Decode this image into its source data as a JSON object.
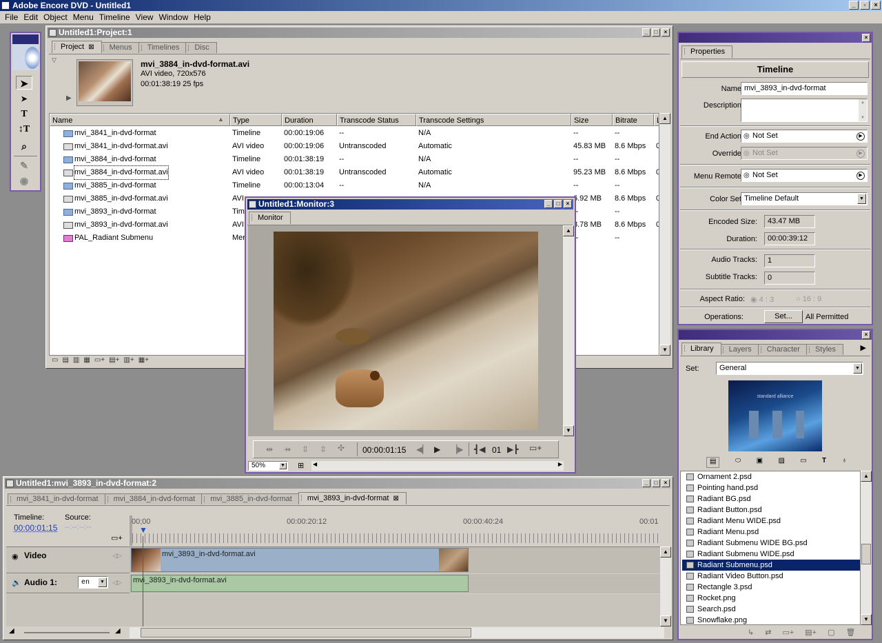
{
  "app": {
    "title": "Adobe Encore DVD - Untitled1"
  },
  "menu": [
    "File",
    "Edit",
    "Object",
    "Menu",
    "Timeline",
    "View",
    "Window",
    "Help"
  ],
  "project": {
    "title": "Untitled1:Project:1",
    "tabs": [
      "Project",
      "Menus",
      "Timelines",
      "Disc"
    ],
    "preview": {
      "name": "mvi_3884_in-dvd-format.avi",
      "type": "AVI video, 720x576",
      "duration": "00:01:38:19 25 fps"
    },
    "columns": [
      "Name",
      "Type",
      "Duration",
      "Transcode Status",
      "Transcode Settings",
      "Size",
      "Bitrate",
      "Last"
    ],
    "rows": [
      {
        "icon": "timeline",
        "name": "mvi_3841_in-dvd-format",
        "type": "Timeline",
        "duration": "00:00:19:06",
        "status": "--",
        "settings": "N/A",
        "size": "--",
        "bitrate": "--",
        "last": ""
      },
      {
        "icon": "avi",
        "name": "mvi_3841_in-dvd-format.avi",
        "type": "AVI video",
        "duration": "00:00:19:06",
        "status": "Untranscoded",
        "settings": "Automatic",
        "size": "45.83 MB",
        "bitrate": "8.6 Mbps",
        "last": "0"
      },
      {
        "icon": "timeline",
        "name": "mvi_3884_in-dvd-format",
        "type": "Timeline",
        "duration": "00:01:38:19",
        "status": "--",
        "settings": "N/A",
        "size": "--",
        "bitrate": "--",
        "last": ""
      },
      {
        "icon": "avi",
        "name": "mvi_3884_in-dvd-format.avi",
        "type": "AVI video",
        "duration": "00:01:38:19",
        "status": "Untranscoded",
        "settings": "Automatic",
        "size": "95.23 MB",
        "bitrate": "8.6 Mbps",
        "last": "0"
      },
      {
        "icon": "timeline",
        "name": "mvi_3885_in-dvd-format",
        "type": "Timeline",
        "duration": "00:00:13:04",
        "status": "--",
        "settings": "N/A",
        "size": "--",
        "bitrate": "--",
        "last": ""
      },
      {
        "icon": "avi",
        "name": "mvi_3885_in-dvd-format.avi",
        "type": "AVI",
        "duration": "",
        "status": "",
        "settings": "",
        "size": "6.92 MB",
        "bitrate": "8.6 Mbps",
        "last": "0"
      },
      {
        "icon": "timeline",
        "name": "mvi_3893_in-dvd-format",
        "type": "Tim",
        "duration": "",
        "status": "",
        "settings": "",
        "size": "--",
        "bitrate": "--",
        "last": ""
      },
      {
        "icon": "avi",
        "name": "mvi_3893_in-dvd-format.avi",
        "type": "AVI",
        "duration": "",
        "status": "",
        "settings": "",
        "size": "8.78 MB",
        "bitrate": "8.6 Mbps",
        "last": "0"
      },
      {
        "icon": "menu",
        "name": "PAL_Radiant Submenu",
        "type": "Mer",
        "duration": "",
        "status": "",
        "settings": "",
        "size": "--",
        "bitrate": "--",
        "last": ""
      }
    ]
  },
  "monitor": {
    "title": "Untitled1:Monitor:3",
    "tab": "Monitor",
    "timecode": "00:00:01:15",
    "chapter": "01",
    "zoom": "50%"
  },
  "properties": {
    "tab": "Properties",
    "heading": "Timeline",
    "name_label": "Name:",
    "name_value": "mvi_3893_in-dvd-format",
    "description_label": "Description:",
    "end_action_label": "End Action:",
    "end_action_value": "Not Set",
    "override_label": "Override:",
    "override_value": "Not Set",
    "menu_remote_label": "Menu Remote:",
    "menu_remote_value": "Not Set",
    "color_set_label": "Color Set:",
    "color_set_value": "Timeline Default",
    "encoded_size_label": "Encoded Size:",
    "encoded_size_value": "43.47 MB",
    "duration_label": "Duration:",
    "duration_value": "00:00:39:12",
    "audio_tracks_label": "Audio Tracks:",
    "audio_tracks_value": "1",
    "subtitle_tracks_label": "Subtitle Tracks:",
    "subtitle_tracks_value": "0",
    "aspect_label": "Aspect Ratio:",
    "aspect_a": "4 : 3",
    "aspect_b": "16 : 9",
    "operations_label": "Operations:",
    "operations_button": "Set...",
    "operations_value": "All Permitted"
  },
  "library": {
    "tabs": [
      "Library",
      "Layers",
      "Character",
      "Styles"
    ],
    "set_label": "Set:",
    "set_value": "General",
    "items": [
      "Ornament 2.psd",
      "Pointing hand.psd",
      "Radiant BG.psd",
      "Radiant Button.psd",
      "Radiant Menu WIDE.psd",
      "Radiant Menu.psd",
      "Radiant Submenu WIDE BG.psd",
      "Radiant Submenu WIDE.psd",
      "Radiant Submenu.psd",
      "Radiant Video Button.psd",
      "Rectangle 3.psd",
      "Rocket.png",
      "Search.psd",
      "Snowflake.png"
    ],
    "selected_index": 8,
    "thumb_text": "standard alliance"
  },
  "timeline": {
    "title": "Untitled1:mvi_3893_in-dvd-format:2",
    "tabs": [
      "mvi_3841_in-dvd-format",
      "mvi_3884_in-dvd-format",
      "mvi_3885_in-dvd-format",
      "mvi_3893_in-dvd-format"
    ],
    "timeline_label": "Timeline:",
    "timeline_tc": "00:00:01:15",
    "source_label": "Source:",
    "source_tc": "--:--:--:--",
    "ruler": [
      "00;00",
      "00:00:20:12",
      "00:00:40:24",
      "00:01"
    ],
    "video_label": "Video",
    "video_clip": "mvi_3893_in-dvd-format.avi",
    "audio_label": "Audio 1:",
    "audio_lang": "en",
    "audio_clip": "mvi_3893_in-dvd-format.avi"
  }
}
